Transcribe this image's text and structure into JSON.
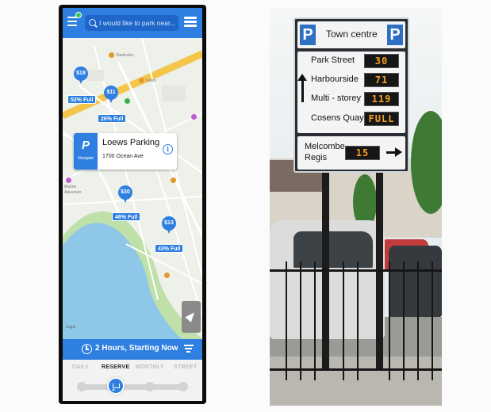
{
  "app": {
    "search": {
      "placeholder": "I would like to park near..."
    },
    "map_labels": {
      "starbucks": "Starbucks",
      "sears": "Sears",
      "marine": "Marine",
      "aquarium": "Aquarium",
      "legal": "Legal"
    },
    "pins": [
      {
        "price": "$18",
        "full": "52% Full"
      },
      {
        "price": "$11",
        "full": "26% Full"
      },
      {
        "price": "$30",
        "full": "46% Full"
      },
      {
        "price": "$13",
        "full": "43% Full"
      }
    ],
    "callout": {
      "title": "Loews Parking",
      "address": "1700 Ocean Ave",
      "navigate_label": "Navigate",
      "info_symbol": "i"
    },
    "duration": {
      "label": "2 Hours, Starting Now"
    },
    "modes": [
      "DAILY",
      "RESERVE",
      "MONTHLY",
      "STREET"
    ],
    "active_mode": "RESERVE",
    "icons": [
      "menu-icon",
      "search-icon",
      "list-icon",
      "navigate-icon",
      "info-icon",
      "location-arrow-icon",
      "clock-icon",
      "filter-icon",
      "cart-icon"
    ]
  },
  "sign": {
    "parking_symbol": "P",
    "title": "Town centre",
    "rows": [
      {
        "name": "Park Street",
        "count": "30"
      },
      {
        "name": "Harbourside",
        "count": "71"
      },
      {
        "name": "Multi - storey",
        "count": "119"
      },
      {
        "name": "Cosens Quay",
        "count": "FULL"
      }
    ],
    "footer": {
      "name": "Melcombe Regis",
      "count": "15"
    }
  },
  "colors": {
    "app_blue": "#2e7fe0",
    "led_amber": "#f3a021",
    "parking_sign_blue": "#2e6fc2"
  }
}
